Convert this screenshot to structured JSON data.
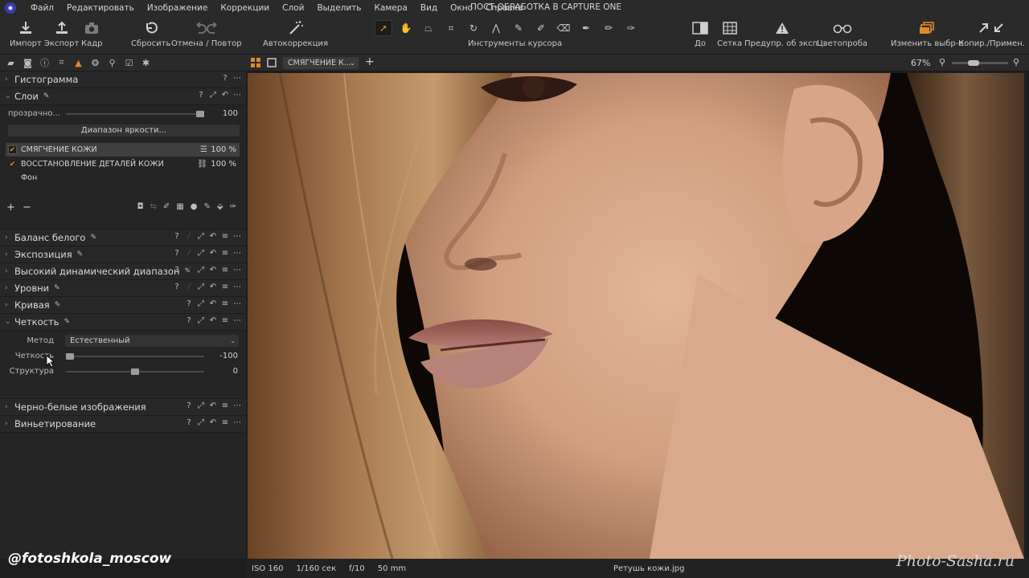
{
  "menubar": {
    "items": [
      "Файл",
      "Редактировать",
      "Изображение",
      "Коррекции",
      "Слой",
      "Выделить",
      "Камера",
      "Вид",
      "Окно",
      "Справка"
    ],
    "app_title": "ПОСТ-ОБРАБОТКА В CAPTURE ONE"
  },
  "toolbar": {
    "import": "Импорт",
    "export": "Экспорт",
    "frame": "Кадр",
    "reset": "Сбросить",
    "undo_redo": "Отмена / Повтор",
    "auto": "Автокоррекция",
    "cursor_tools": "Инструменты курсора",
    "before": "До",
    "grid": "Сетка",
    "warning": "Предупр. об эксп.",
    "proof": "Цветопроба",
    "edit_selection": "Изменить выбр-е",
    "copy_apply": "Копир./Примен."
  },
  "viewer": {
    "variant_name": "СМЯГЧЕНИЕ К...",
    "zoom": "67%"
  },
  "panel": {
    "histogram": "Гистограмма",
    "layers": {
      "title": "Слои",
      "opacity_label": "прозрачно...",
      "opacity_value": "100",
      "opacity_fraction": 1.0,
      "luma_range_button": "Диапазон яркости...",
      "items": [
        {
          "name": "СМЯГЧЕНИЕ КОЖИ",
          "pct": "100 %"
        },
        {
          "name": "ВОССТАНОВЛЕНИЕ ДЕТАЛЕЙ КОЖИ",
          "pct": "100 %"
        },
        {
          "name": "Фон"
        }
      ]
    },
    "white_balance": "Баланс белого",
    "exposure": "Экспозиция",
    "hdr": "Высокий динамический диапазон",
    "levels": "Уровни",
    "curve": "Кривая",
    "clarity": {
      "title": "Четкость",
      "method_label": "Метод",
      "method_value": "Естественный",
      "clarity_label": "Четкость",
      "clarity_value": "-100",
      "clarity_fraction": 0.0,
      "structure_label": "Структура",
      "structure_value": "0",
      "structure_fraction": 0.5
    },
    "bw": "Черно-белые изображения",
    "vignette": "Виньетирование"
  },
  "status": {
    "iso": "ISO 160",
    "shutter": "1/160 сек",
    "aperture": "f/10",
    "focal": "50 mm",
    "filename": "Ретушь кожи.jpg"
  },
  "watermarks": {
    "left": "@fotoshkola_moscow",
    "right": "Photo-Sasha.ru"
  },
  "colors": {
    "accent": "#e08a2a",
    "panel_bg": "#252525",
    "toolbar_bg": "#2a2a2a"
  }
}
